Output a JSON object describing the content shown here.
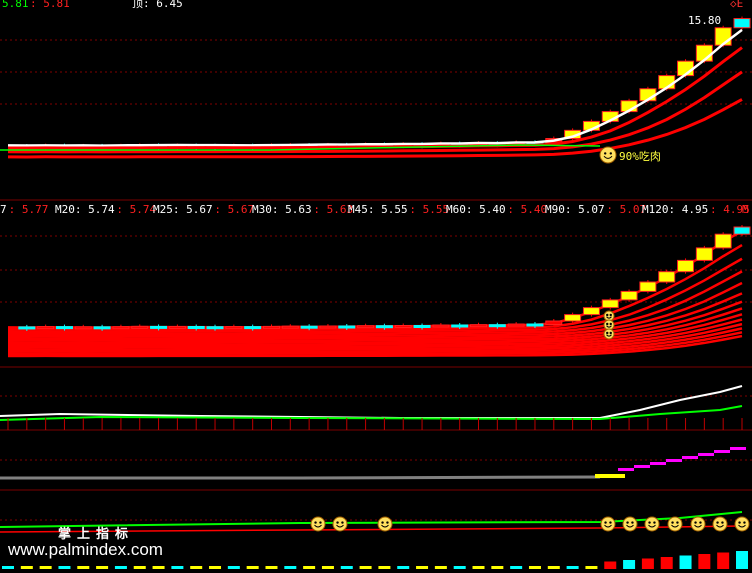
{
  "colors": {
    "background": "#000000",
    "up": "#ff0000",
    "down_bar": "#00ffff",
    "yellow_bar": "#ffff00",
    "ma_white": "#ffffff",
    "ma_green": "#00ff00",
    "magenta": "#ff00ff",
    "label_white": "#ffffff",
    "label_red": "#ff2020",
    "smiley": "#ffe060"
  },
  "top_panel": {
    "header_left_1": "5.81",
    "header_left_2": ": 5.81",
    "header_mid": "顶: 6.45",
    "price_high_label": "15.80",
    "annotation_label": "90%吃肉",
    "corner_glyph": "◇E"
  },
  "ma_header": {
    "items": [
      {
        "label": "7",
        "value": ": 5.77"
      },
      {
        "label": "M20: 5.74",
        "value": ": 5.74"
      },
      {
        "label": "M25: 5.67",
        "value": ": 5.67"
      },
      {
        "label": "M30: 5.63",
        "value": ": 5.63"
      },
      {
        "label": "M45: 5.55",
        "value": ": 5.55"
      },
      {
        "label": "M60: 5.40",
        "value": ": 5.40"
      },
      {
        "label": "M90: 5.07",
        "value": ": 5.07"
      },
      {
        "label": "M120: 4.95",
        "value": ": 4.95"
      },
      {
        "label": "",
        "value": "M"
      }
    ]
  },
  "watermark": {
    "cn": "掌上指标",
    "url": "www.palmindex.com"
  },
  "chart_data": {
    "type": "candlestick",
    "last_close": 15.8,
    "closes": [
      5.81,
      5.8,
      5.84,
      5.78,
      5.82,
      5.79,
      5.83,
      5.86,
      5.82,
      5.85,
      5.83,
      5.81,
      5.84,
      5.8,
      5.86,
      5.88,
      5.85,
      5.9,
      5.87,
      5.93,
      5.89,
      5.95,
      5.92,
      6.0,
      5.96,
      6.03,
      5.98,
      6.1,
      6.05,
      6.4,
      7.04,
      7.74,
      8.51,
      9.36,
      10.3,
      11.33,
      12.46,
      13.71,
      15.08,
      15.8
    ]
  }
}
